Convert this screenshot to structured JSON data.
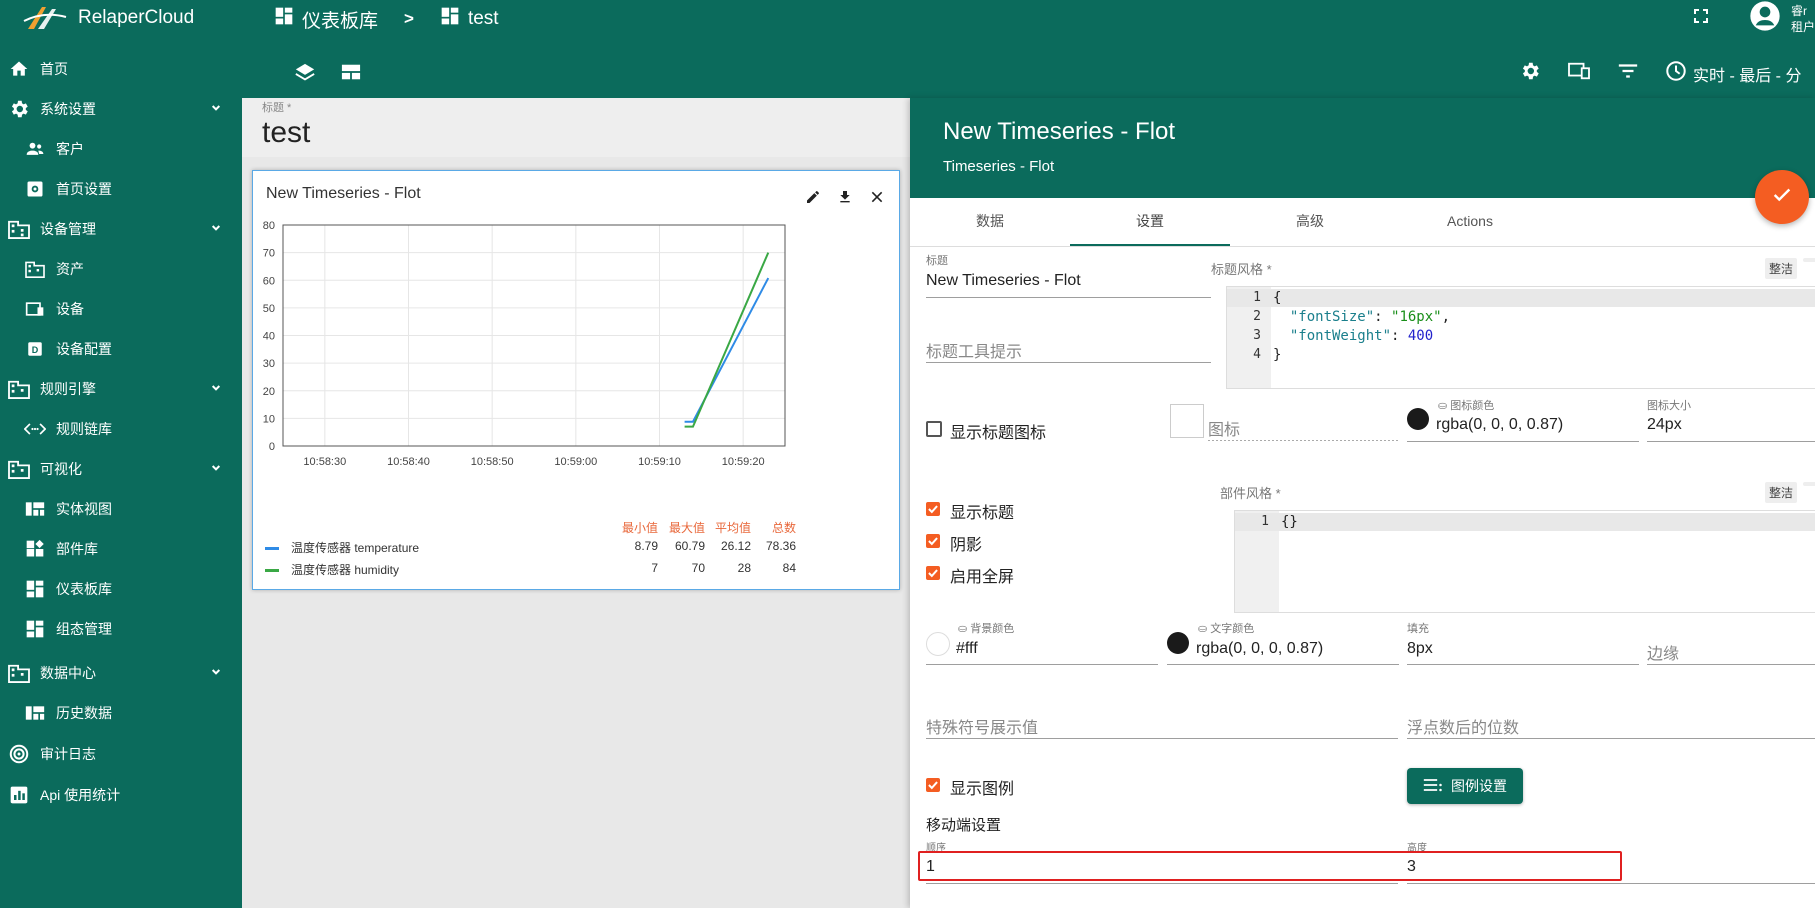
{
  "app": {
    "name": "RelaperCloud",
    "accent": "#0b6b5c",
    "highlight": "#f45d22"
  },
  "sidebar": {
    "items": [
      {
        "label": "首页",
        "icon": "home-icon"
      },
      {
        "label": "系统设置",
        "icon": "gear-icon"
      },
      {
        "label": "客户",
        "icon": "people-icon"
      },
      {
        "label": "首页设置",
        "icon": "settings-box-icon"
      },
      {
        "label": "设备管理",
        "icon": "building-icon"
      },
      {
        "label": "资产",
        "icon": "building-icon"
      },
      {
        "label": "设备",
        "icon": "device-icon"
      },
      {
        "label": "设备配置",
        "icon": "device-profile-icon"
      },
      {
        "label": "规则引擎",
        "icon": "building-icon"
      },
      {
        "label": "规则链库",
        "icon": "code-icon"
      },
      {
        "label": "可视化",
        "icon": "building-icon"
      },
      {
        "label": "实体视图",
        "icon": "view-quilt-icon"
      },
      {
        "label": "部件库",
        "icon": "widgets-icon"
      },
      {
        "label": "仪表板库",
        "icon": "dashboard-icon"
      },
      {
        "label": "组态管理",
        "icon": "dashboard-icon"
      },
      {
        "label": "数据中心",
        "icon": "building-icon"
      },
      {
        "label": "历史数据",
        "icon": "view-quilt-icon"
      },
      {
        "label": "审计日志",
        "icon": "track-icon"
      },
      {
        "label": "Api 使用统计",
        "icon": "chart-icon"
      }
    ]
  },
  "header": {
    "breadcrumb": [
      "仪表板库",
      "test"
    ],
    "user_line1": "睿r",
    "user_line2": "租户",
    "timewindow": "实时 - 最后 - 分"
  },
  "dashboard": {
    "title_label": "标题 *",
    "title": "test"
  },
  "widget": {
    "title": "New Timeseries - Flot",
    "legend_headers": [
      "最小值",
      "最大值",
      "平均值",
      "总数"
    ],
    "legend_rows": [
      {
        "name": "温度传感器 temperature",
        "color": "#2f8be6",
        "min": "8.79",
        "max": "60.79",
        "avg": "26.12",
        "total": "78.36"
      },
      {
        "name": "温度传感器 humidity",
        "color": "#3aa845",
        "min": "7",
        "max": "70",
        "avg": "28",
        "total": "84"
      }
    ]
  },
  "chart_data": {
    "type": "line",
    "x_ticks": [
      "10:58:30",
      "10:58:40",
      "10:58:50",
      "10:59:00",
      "10:59:10",
      "10:59:20"
    ],
    "y_ticks": [
      0,
      10,
      20,
      30,
      40,
      50,
      60,
      70,
      80
    ],
    "ylim": [
      0,
      80
    ],
    "xlim": [
      "10:58:25",
      "10:59:25"
    ],
    "series": [
      {
        "name": "温度传感器 temperature",
        "color": "#2f8be6",
        "points": [
          [
            "10:59:13",
            8.79
          ],
          [
            "10:59:14",
            8.79
          ],
          [
            "10:59:23",
            60.79
          ]
        ]
      },
      {
        "name": "温度传感器 humidity",
        "color": "#3aa845",
        "points": [
          [
            "10:59:13",
            7
          ],
          [
            "10:59:14",
            7
          ],
          [
            "10:59:23",
            70
          ]
        ]
      }
    ],
    "grid": true
  },
  "panel": {
    "title": "New Timeseries - Flot",
    "subtitle": "Timeseries - Flot",
    "tabs": [
      "数据",
      "设置",
      "高级",
      "Actions"
    ],
    "active_tab": "设置",
    "fields": {
      "title_label": "标题",
      "title_value": "New Timeseries - Flot",
      "title_style_label": "标题风格 *",
      "tidy_label": "整洁",
      "tooltip_placeholder": "标题工具提示",
      "show_title_icon": "显示标题图标",
      "icon_placeholder": "图标",
      "icon_color_label": "图标颜色",
      "icon_color_value": "rgba(0, 0, 0, 0.87)",
      "icon_size_label": "图标大小",
      "icon_size_value": "24px",
      "widget_style_label": "部件风格 *",
      "show_title": "显示标题",
      "shadow": "阴影",
      "fullscreen": "启用全屏",
      "bg_color_label": "背景颜色",
      "bg_color_value": "#fff",
      "text_color_label": "文字颜色",
      "text_color_value": "rgba(0, 0, 0, 0.87)",
      "padding_label": "填充",
      "padding_value": "8px",
      "margin_placeholder": "边缘",
      "special_symbol_placeholder": "特殊符号展示值",
      "decimals_placeholder": "浮点数后的位数",
      "show_legend": "显示图例",
      "legend_settings_btn": "图例设置",
      "mobile_settings": "移动端设置",
      "order_label": "顺序",
      "order_value": "1",
      "height_label": "高度",
      "height_value": "3"
    },
    "title_style_code": [
      "{",
      "  \"fontSize\": \"16px\",",
      "  \"fontWeight\": 400",
      "}"
    ],
    "widget_style_code": [
      "{}"
    ]
  }
}
